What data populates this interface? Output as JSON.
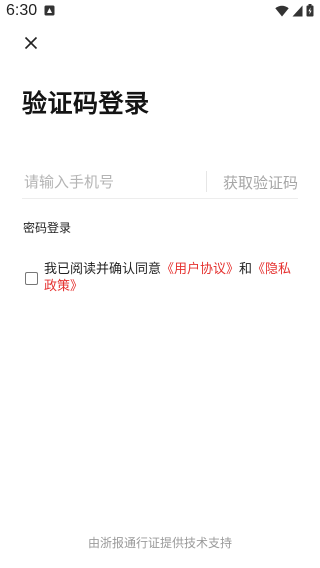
{
  "status_bar": {
    "time": "6:30",
    "notification_icon": "app-notification-icon",
    "wifi_icon": "wifi-icon",
    "signal_icon": "signal-icon",
    "battery_icon": "battery-icon"
  },
  "header": {
    "close_icon": "close-icon",
    "title": "验证码登录"
  },
  "form": {
    "phone_placeholder": "请输入手机号",
    "phone_value": "",
    "get_code_label": "获取验证码",
    "password_login_label": "密码登录"
  },
  "agreement": {
    "checked": false,
    "prefix": "我已阅读并确认同意",
    "user_agreement": "《用户协议》",
    "and": "和",
    "privacy_policy": "《隐私政策》"
  },
  "footer": {
    "text": "由浙报通行证提供技术支持"
  },
  "colors": {
    "link": "#e5312f",
    "placeholder": "#b4b4b4",
    "muted": "#9a9a9a"
  }
}
